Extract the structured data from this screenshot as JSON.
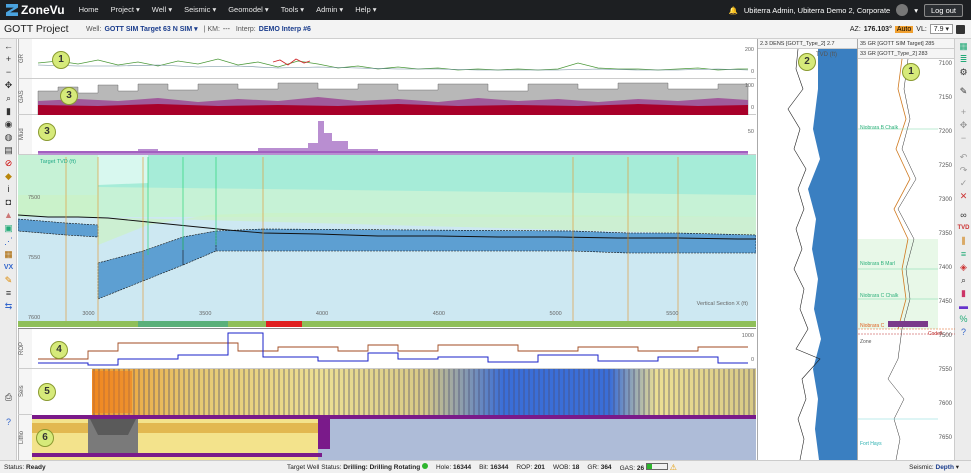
{
  "app": {
    "logo": "ZoneVu"
  },
  "nav": [
    "Home",
    "Project",
    "Well",
    "Seismic",
    "Geomodel",
    "Tools",
    "Admin",
    "Help"
  ],
  "user": {
    "label": "Ubiterra Admin, Ubiterra Demo 2, Corporate",
    "logout": "Log out"
  },
  "project": {
    "title": "GOTT Project",
    "well_label": "Well:",
    "well_value": "GOTT SIM Target 63  N SIM",
    "km_label": "| KM:",
    "km_value": "---",
    "interp_label": "Interp:",
    "interp_value": "DEMO Interp #6",
    "az_label": "AZ:",
    "az_value": "176.103°",
    "auto": "Auto",
    "vl_label": "VL:",
    "vl_value": "7.9"
  },
  "strips": {
    "gr_label": "GR",
    "gr_scale_top": "200",
    "gr_scale_bottom": "0",
    "gas_label": "GAS",
    "gas_scale_top": "100",
    "gas_scale_bottom": "0",
    "mud_label": "Mud",
    "mud_scale": "50",
    "rop_label": "ROP",
    "rop_scale_top": "1000",
    "rop_scale_bottom": "0",
    "seis_label": "Seis",
    "litho_label": "Litho"
  },
  "section": {
    "target_tvd_label": "Target TVD (ft)",
    "tvd_ticks": [
      "7500",
      "7550",
      "7600"
    ],
    "vs_label": "Vertical Section X (ft)",
    "vs_ticks": [
      "3000",
      "3500",
      "4000",
      "4500",
      "5000",
      "5500"
    ],
    "vs_values": [
      3000,
      3500,
      4000,
      4500,
      5000,
      5500
    ]
  },
  "panels": {
    "dens_header": "DENS [GOTT_Type_2]",
    "dens_tvd": "TVD (ft)",
    "gr_header": "GR [GOTT SIM Target]",
    "gr2_header": "GR [GOTT_Type_2]",
    "dens_range_left": "2.3",
    "dens_range_right": "2.7",
    "gr_range_left": "35",
    "gr_range_right": "285",
    "gr2_range_left": "33",
    "gr2_range_right": "283",
    "depth_ticks": [
      "7100",
      "7150",
      "7200",
      "7250",
      "7300",
      "7350",
      "7400",
      "7450",
      "7500",
      "7550",
      "7600",
      "7650",
      "7700"
    ],
    "annotations": {
      "a1": "Niobrara B Chalk",
      "a2": "Niobrara B Marl",
      "a3": "Niobrara C Chalk",
      "a4": "Niobrara C",
      "a5": "Zone",
      "a6": "Fort Hays",
      "a7": "Codell"
    }
  },
  "status": {
    "status_label": "Status:",
    "status_value": "Ready",
    "tgt_label": "Target Well Status:",
    "tgt_value": "Drilling: Drilling Rotating",
    "hole_label": "Hole:",
    "hole_value": "16344",
    "bit_label": "Bit:",
    "bit_value": "16344",
    "rop_label": "ROP:",
    "rop_value": "201",
    "wob_label": "WOB:",
    "wob_value": "18",
    "gr_label": "GR:",
    "gr_value": "364",
    "gas_label": "GAS:",
    "gas_value": "26",
    "gas_fraction": 0.26,
    "seismic_label": "Seismic:",
    "seismic_value": "Depth"
  },
  "markers": [
    "1",
    "2",
    "3",
    "3",
    "4",
    "5",
    "6",
    "1"
  ],
  "colors": {
    "accent": "#1a3c8c",
    "dens": "#3a7fc1",
    "gr_trace": "#4d9a3a",
    "mud": "#a25fc0",
    "gas_red": "#a8002a",
    "green_fill": "#b8f0c8"
  }
}
